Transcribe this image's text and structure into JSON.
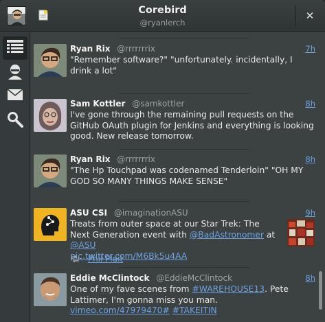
{
  "header": {
    "title": "Corebird",
    "subtitle": "@ryanlerch",
    "close_glyph": "✕"
  },
  "sidebar": {
    "items": [
      {
        "name": "timeline",
        "icon": "stream-icon",
        "active": true
      },
      {
        "name": "mentions",
        "icon": "user-icon",
        "active": false
      },
      {
        "name": "messages",
        "icon": "envelope-icon",
        "active": false
      },
      {
        "name": "search",
        "icon": "search-icon",
        "active": false
      }
    ]
  },
  "tweets": [
    {
      "name": "Ryan Rix",
      "handle": "@rrrrrrrix",
      "time": "7h",
      "text": "\"Remember software?\" \"unfortunately. incidentally, I drink a lot\""
    },
    {
      "name": "Sam Kottler",
      "handle": "@samkottler",
      "time": "8h",
      "text": "I've gone through the remaining pull requests on the GitHub OAuth plugin for Jenkins and everything is looking good. New release tomorrow."
    },
    {
      "name": "Ryan Rix",
      "handle": "@rrrrrrrix",
      "time": "8h",
      "text": "\"The Hp Touchpad was codenamed Tenderloin\" \"OH MY GOD SO MANY THINGS MAKE SENSE\""
    },
    {
      "name": "ASU CSI",
      "handle": "@imaginationASU",
      "time": "9h",
      "text_pre": "Treats from outer space at our Star Trek: The Next Generation event with ",
      "mention1": "@BadAstronomer",
      "text_mid": " at ",
      "mention2": "@ASU",
      "url": "pic.twitter.com/M6Bk5u4AA",
      "retweeted_by": "Phil Plait"
    },
    {
      "name": "Eddie McClintock",
      "handle": "@EddieMcClintock",
      "time": "8h",
      "text_pre": "One of my fave scenes from ",
      "hashtag1": "#WAREHOUSE13",
      "text_mid": ". Pete Lattimer, I'm gonna miss you man. ",
      "url": "vimeo.com/47979470#",
      "hashtag2": "#TAKEITIN"
    }
  ],
  "colors": {
    "accent_link": "#6fa0e0",
    "background": "#3c4242",
    "header": "#2f3435"
  }
}
